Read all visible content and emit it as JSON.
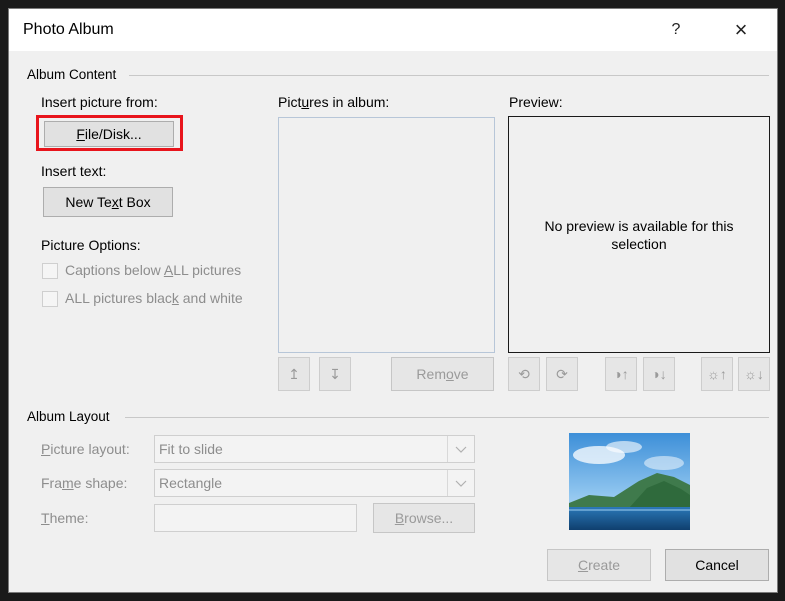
{
  "dialog": {
    "title": "Photo Album",
    "help_glyph": "?",
    "close_glyph": "×"
  },
  "album_content": {
    "group_label": "Album Content",
    "insert_picture_from": "Insert picture from:",
    "file_disk_button": "File/Disk...",
    "insert_text": "Insert text:",
    "new_text_box_button": "New Text Box",
    "picture_options": "Picture Options:",
    "captions_below_all": "Captions below ALL pictures",
    "all_black_white": "ALL pictures black and white",
    "pictures_in_album": "Pictures in album:",
    "preview_label": "Preview:",
    "no_preview_text": "No preview is available for this selection",
    "remove_button": "Remove"
  },
  "album_layout": {
    "group_label": "Album Layout",
    "picture_layout_label": "Picture layout:",
    "picture_layout_value": "Fit to slide",
    "frame_shape_label": "Frame shape:",
    "frame_shape_value": "Rectangle",
    "theme_label": "Theme:",
    "theme_value": "",
    "browse_button": "Browse..."
  },
  "footer": {
    "create_button": "Create",
    "cancel_button": "Cancel"
  },
  "icons": {
    "move_up": "move-up-icon",
    "move_down": "move-down-icon",
    "rotate_left": "rotate-left-icon",
    "rotate_right": "rotate-right-icon",
    "contrast_up": "contrast-up-icon",
    "contrast_down": "contrast-down-icon",
    "brightness_up": "brightness-up-icon",
    "brightness_down": "brightness-down-icon"
  },
  "colors": {
    "highlight": "#e8141c"
  }
}
